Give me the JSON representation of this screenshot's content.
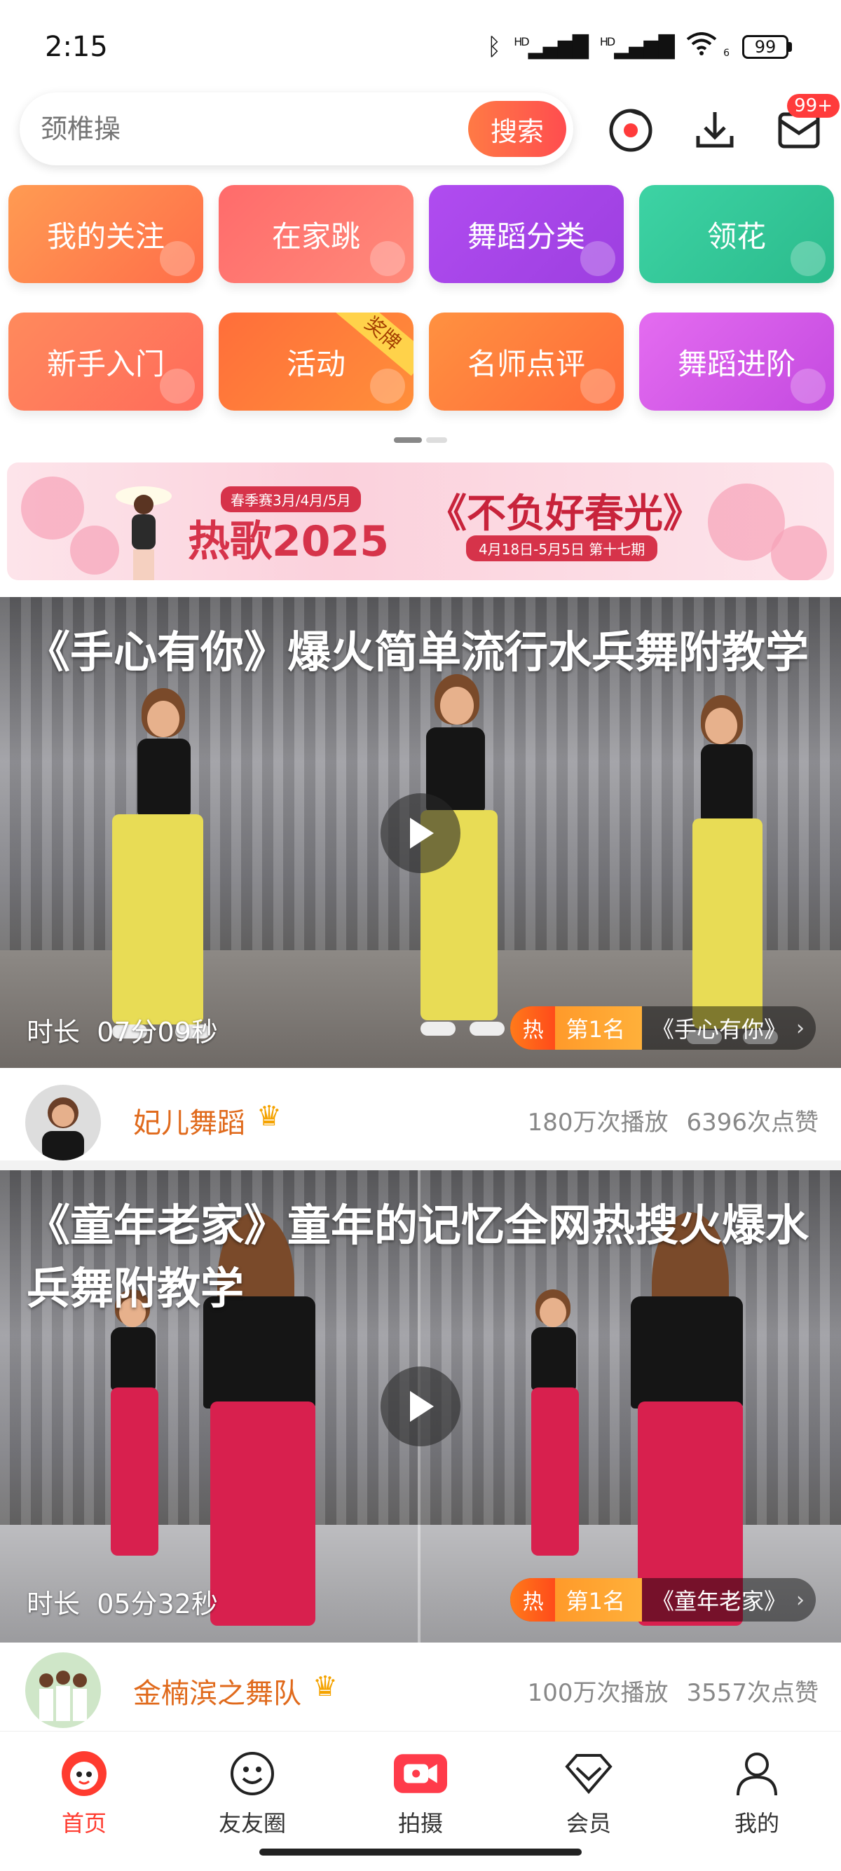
{
  "status_bar": {
    "time": "2:15",
    "battery": "99",
    "signal_label": "HD",
    "wifi_label": "6"
  },
  "search": {
    "placeholder": "颈椎操",
    "button_label": "搜索"
  },
  "top_actions": {
    "inbox_badge": "99+"
  },
  "categories": [
    {
      "label": "我的关注",
      "color_from": "#ff9b52",
      "color_to": "#ff6e4a"
    },
    {
      "label": "在家跳",
      "color_from": "#ff6b6b",
      "color_to": "#ff8a7a"
    },
    {
      "label": "舞蹈分类",
      "color_from": "#b04cf0",
      "color_to": "#9d3fe0"
    },
    {
      "label": "领花",
      "color_from": "#3dd3a4",
      "color_to": "#2bbb8c"
    },
    {
      "label": "新手入门",
      "color_from": "#ff8a5c",
      "color_to": "#ff6b5b"
    },
    {
      "label": "活动",
      "color_from": "#ff6e3a",
      "color_to": "#ff8f3a",
      "ribbon": "奖牌"
    },
    {
      "label": "名师点评",
      "color_from": "#ff9140",
      "color_to": "#ff6b3a"
    },
    {
      "label": "舞蹈进阶",
      "color_from": "#e46cf0",
      "color_to": "#c44ae0"
    }
  ],
  "banner": {
    "season_tag": "春季赛3月/4月/5月",
    "hot_label": "热歌2025",
    "title": "《不负好春光》",
    "date_range": "4月18日-5月5日 第十七期"
  },
  "videos": [
    {
      "title": "《手心有你》爆火简单流行水兵舞附教学",
      "duration_label": "时长",
      "duration": "07分09秒",
      "rank_hot": "热",
      "rank_no": "第1名",
      "rank_song": "《手心有你》",
      "author": "妃儿舞蹈",
      "plays": "180万次播放",
      "likes": "6396次点赞",
      "pants_color": "#e8dc55"
    },
    {
      "title": "《童年老家》童年的记忆全网热搜火爆水兵舞附教学",
      "duration_label": "时长",
      "duration": "05分32秒",
      "rank_hot": "热",
      "rank_no": "第1名",
      "rank_song": "《童年老家》",
      "author": "金楠滨之舞队",
      "plays": "100万次播放",
      "likes": "3557次点赞",
      "pants_color": "#d8204e"
    }
  ],
  "bottom_nav": [
    {
      "label": "首页",
      "icon": "home-icon",
      "active": true
    },
    {
      "label": "友友圈",
      "icon": "smile-icon",
      "active": false
    },
    {
      "label": "拍摄",
      "icon": "camera-record-icon",
      "active": false
    },
    {
      "label": "会员",
      "icon": "diamond-icon",
      "active": false
    },
    {
      "label": "我的",
      "icon": "person-icon",
      "active": false
    }
  ],
  "accent_color": "#ff3b2f"
}
